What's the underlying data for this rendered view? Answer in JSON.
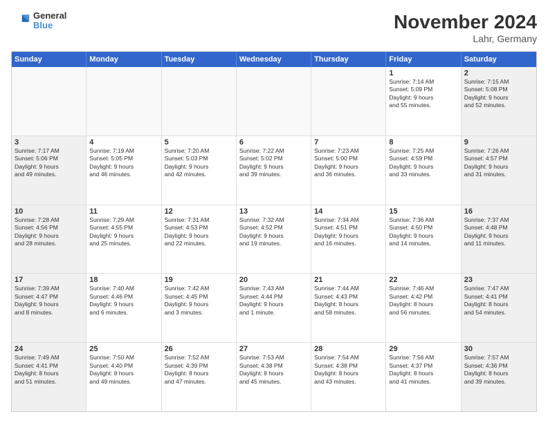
{
  "logo": {
    "line1": "General",
    "line2": "Blue"
  },
  "title": "November 2024",
  "location": "Lahr, Germany",
  "header_days": [
    "Sunday",
    "Monday",
    "Tuesday",
    "Wednesday",
    "Thursday",
    "Friday",
    "Saturday"
  ],
  "weeks": [
    [
      {
        "day": "",
        "info": "",
        "empty": true
      },
      {
        "day": "",
        "info": "",
        "empty": true
      },
      {
        "day": "",
        "info": "",
        "empty": true
      },
      {
        "day": "",
        "info": "",
        "empty": true
      },
      {
        "day": "",
        "info": "",
        "empty": true
      },
      {
        "day": "1",
        "info": "Sunrise: 7:14 AM\nSunset: 5:09 PM\nDaylight: 9 hours\nand 55 minutes.",
        "empty": false
      },
      {
        "day": "2",
        "info": "Sunrise: 7:15 AM\nSunset: 5:08 PM\nDaylight: 9 hours\nand 52 minutes.",
        "empty": false
      }
    ],
    [
      {
        "day": "3",
        "info": "Sunrise: 7:17 AM\nSunset: 5:06 PM\nDaylight: 9 hours\nand 49 minutes.",
        "empty": false
      },
      {
        "day": "4",
        "info": "Sunrise: 7:19 AM\nSunset: 5:05 PM\nDaylight: 9 hours\nand 46 minutes.",
        "empty": false
      },
      {
        "day": "5",
        "info": "Sunrise: 7:20 AM\nSunset: 5:03 PM\nDaylight: 9 hours\nand 42 minutes.",
        "empty": false
      },
      {
        "day": "6",
        "info": "Sunrise: 7:22 AM\nSunset: 5:02 PM\nDaylight: 9 hours\nand 39 minutes.",
        "empty": false
      },
      {
        "day": "7",
        "info": "Sunrise: 7:23 AM\nSunset: 5:00 PM\nDaylight: 9 hours\nand 36 minutes.",
        "empty": false
      },
      {
        "day": "8",
        "info": "Sunrise: 7:25 AM\nSunset: 4:59 PM\nDaylight: 9 hours\nand 33 minutes.",
        "empty": false
      },
      {
        "day": "9",
        "info": "Sunrise: 7:26 AM\nSunset: 4:57 PM\nDaylight: 9 hours\nand 31 minutes.",
        "empty": false
      }
    ],
    [
      {
        "day": "10",
        "info": "Sunrise: 7:28 AM\nSunset: 4:56 PM\nDaylight: 9 hours\nand 28 minutes.",
        "empty": false
      },
      {
        "day": "11",
        "info": "Sunrise: 7:29 AM\nSunset: 4:55 PM\nDaylight: 9 hours\nand 25 minutes.",
        "empty": false
      },
      {
        "day": "12",
        "info": "Sunrise: 7:31 AM\nSunset: 4:53 PM\nDaylight: 9 hours\nand 22 minutes.",
        "empty": false
      },
      {
        "day": "13",
        "info": "Sunrise: 7:32 AM\nSunset: 4:52 PM\nDaylight: 9 hours\nand 19 minutes.",
        "empty": false
      },
      {
        "day": "14",
        "info": "Sunrise: 7:34 AM\nSunset: 4:51 PM\nDaylight: 9 hours\nand 16 minutes.",
        "empty": false
      },
      {
        "day": "15",
        "info": "Sunrise: 7:36 AM\nSunset: 4:50 PM\nDaylight: 9 hours\nand 14 minutes.",
        "empty": false
      },
      {
        "day": "16",
        "info": "Sunrise: 7:37 AM\nSunset: 4:48 PM\nDaylight: 9 hours\nand 11 minutes.",
        "empty": false
      }
    ],
    [
      {
        "day": "17",
        "info": "Sunrise: 7:39 AM\nSunset: 4:47 PM\nDaylight: 9 hours\nand 8 minutes.",
        "empty": false
      },
      {
        "day": "18",
        "info": "Sunrise: 7:40 AM\nSunset: 4:46 PM\nDaylight: 9 hours\nand 6 minutes.",
        "empty": false
      },
      {
        "day": "19",
        "info": "Sunrise: 7:42 AM\nSunset: 4:45 PM\nDaylight: 9 hours\nand 3 minutes.",
        "empty": false
      },
      {
        "day": "20",
        "info": "Sunrise: 7:43 AM\nSunset: 4:44 PM\nDaylight: 9 hours\nand 1 minute.",
        "empty": false
      },
      {
        "day": "21",
        "info": "Sunrise: 7:44 AM\nSunset: 4:43 PM\nDaylight: 8 hours\nand 58 minutes.",
        "empty": false
      },
      {
        "day": "22",
        "info": "Sunrise: 7:46 AM\nSunset: 4:42 PM\nDaylight: 8 hours\nand 56 minutes.",
        "empty": false
      },
      {
        "day": "23",
        "info": "Sunrise: 7:47 AM\nSunset: 4:41 PM\nDaylight: 8 hours\nand 54 minutes.",
        "empty": false
      }
    ],
    [
      {
        "day": "24",
        "info": "Sunrise: 7:49 AM\nSunset: 4:41 PM\nDaylight: 8 hours\nand 51 minutes.",
        "empty": false
      },
      {
        "day": "25",
        "info": "Sunrise: 7:50 AM\nSunset: 4:40 PM\nDaylight: 8 hours\nand 49 minutes.",
        "empty": false
      },
      {
        "day": "26",
        "info": "Sunrise: 7:52 AM\nSunset: 4:39 PM\nDaylight: 8 hours\nand 47 minutes.",
        "empty": false
      },
      {
        "day": "27",
        "info": "Sunrise: 7:53 AM\nSunset: 4:38 PM\nDaylight: 8 hours\nand 45 minutes.",
        "empty": false
      },
      {
        "day": "28",
        "info": "Sunrise: 7:54 AM\nSunset: 4:38 PM\nDaylight: 8 hours\nand 43 minutes.",
        "empty": false
      },
      {
        "day": "29",
        "info": "Sunrise: 7:56 AM\nSunset: 4:37 PM\nDaylight: 8 hours\nand 41 minutes.",
        "empty": false
      },
      {
        "day": "30",
        "info": "Sunrise: 7:57 AM\nSunset: 4:36 PM\nDaylight: 8 hours\nand 39 minutes.",
        "empty": false
      }
    ]
  ]
}
